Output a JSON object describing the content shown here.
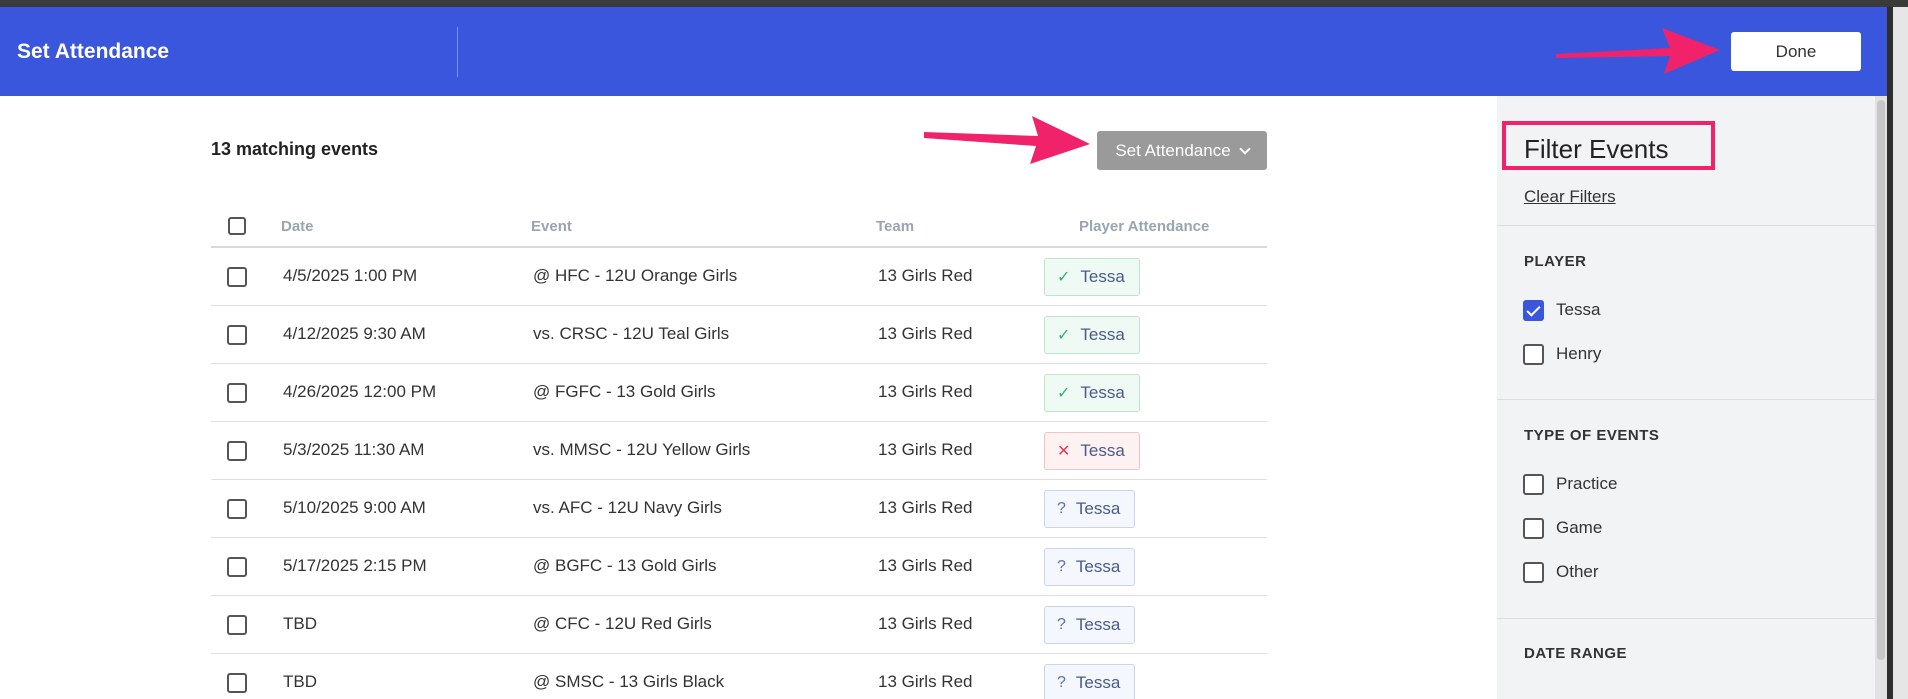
{
  "header": {
    "title": "Set Attendance",
    "done_label": "Done"
  },
  "toolbar": {
    "match_count": "13 matching events",
    "set_attendance_label": "Set Attendance"
  },
  "table": {
    "columns": [
      "Date",
      "Event",
      "Team",
      "Player Attendance"
    ],
    "rows": [
      {
        "date": "4/5/2025 1:00 PM",
        "event": "@ HFC - 12U Orange Girls",
        "team": "13 Girls Red",
        "player": "Tessa",
        "status": "yes",
        "symbol": "✓"
      },
      {
        "date": "4/12/2025 9:30 AM",
        "event": "vs. CRSC - 12U Teal Girls",
        "team": "13 Girls Red",
        "player": "Tessa",
        "status": "yes",
        "symbol": "✓"
      },
      {
        "date": "4/26/2025 12:00 PM",
        "event": "@ FGFC - 13 Gold Girls",
        "team": "13 Girls Red",
        "player": "Tessa",
        "status": "yes",
        "symbol": "✓"
      },
      {
        "date": "5/3/2025 11:30 AM",
        "event": "vs. MMSC - 12U Yellow Girls",
        "team": "13 Girls Red",
        "player": "Tessa",
        "status": "no",
        "symbol": "✕"
      },
      {
        "date": "5/10/2025 9:00 AM",
        "event": "vs. AFC - 12U Navy Girls",
        "team": "13 Girls Red",
        "player": "Tessa",
        "status": "maybe",
        "symbol": "?"
      },
      {
        "date": "5/17/2025 2:15 PM",
        "event": "@ BGFC - 13 Gold Girls",
        "team": "13 Girls Red",
        "player": "Tessa",
        "status": "maybe",
        "symbol": "?"
      },
      {
        "date": "TBD",
        "event": "@ CFC - 12U Red Girls",
        "team": "13 Girls Red",
        "player": "Tessa",
        "status": "maybe",
        "symbol": "?"
      },
      {
        "date": "TBD",
        "event": "@ SMSC - 13 Girls Black",
        "team": "13 Girls Red",
        "player": "Tessa",
        "status": "maybe",
        "symbol": "?"
      }
    ]
  },
  "sidebar": {
    "title": "Filter Events",
    "clear_label": "Clear Filters",
    "player_heading": "PLAYER",
    "players": [
      {
        "label": "Tessa",
        "checked": true
      },
      {
        "label": "Henry",
        "checked": false
      }
    ],
    "type_heading": "TYPE OF EVENTS",
    "types": [
      {
        "label": "Practice",
        "checked": false
      },
      {
        "label": "Game",
        "checked": false
      },
      {
        "label": "Other",
        "checked": false
      }
    ],
    "date_heading": "DATE RANGE"
  },
  "colors": {
    "header_bg": "#3a56dc",
    "annotation": "#f0236a",
    "yes": "#33b36b",
    "no": "#e0425a",
    "maybe": "#5b6fb0"
  },
  "icons": {
    "yes": "checkmark-icon",
    "no": "x-mark-icon",
    "maybe": "question-mark-icon",
    "dropdown": "chevron-down-icon"
  }
}
